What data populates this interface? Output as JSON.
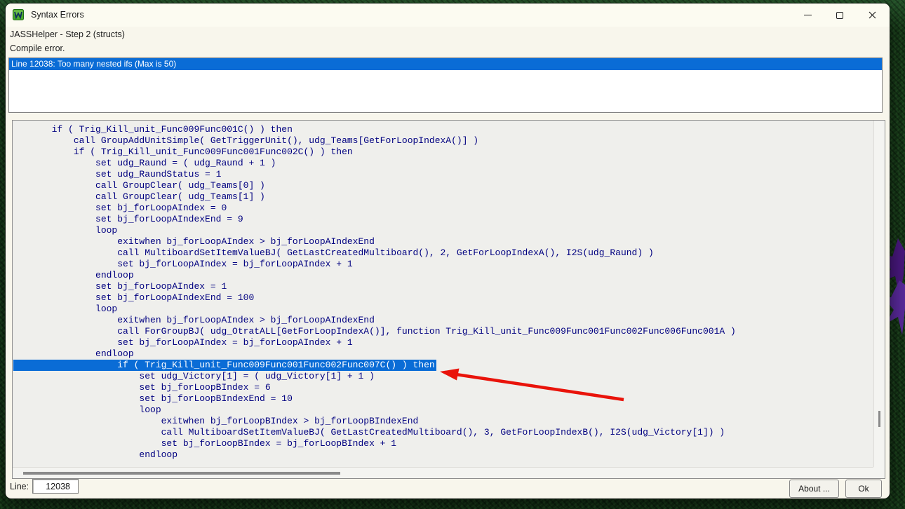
{
  "window": {
    "title": "Syntax Errors",
    "icon": "jasshelper-app-icon",
    "subtitle": "JASSHelper - Step 2 (structs)",
    "status_message": "Compile error."
  },
  "error_list": {
    "items": [
      {
        "text": "Line 12038: Too many nested ifs (Max is 50)",
        "selected": true
      }
    ]
  },
  "code_view": {
    "highlighted_line_index": 21,
    "lines": [
      "       if ( Trig_Kill_unit_Func009Func001C() ) then",
      "           call GroupAddUnitSimple( GetTriggerUnit(), udg_Teams[GetForLoopIndexA()] )",
      "           if ( Trig_Kill_unit_Func009Func001Func002C() ) then",
      "               set udg_Raund = ( udg_Raund + 1 )",
      "               set udg_RaundStatus = 1",
      "               call GroupClear( udg_Teams[0] )",
      "               call GroupClear( udg_Teams[1] )",
      "               set bj_forLoopAIndex = 0",
      "               set bj_forLoopAIndexEnd = 9",
      "               loop",
      "                   exitwhen bj_forLoopAIndex > bj_forLoopAIndexEnd",
      "                   call MultiboardSetItemValueBJ( GetLastCreatedMultiboard(), 2, GetForLoopIndexA(), I2S(udg_Raund) )",
      "                   set bj_forLoopAIndex = bj_forLoopAIndex + 1",
      "               endloop",
      "               set bj_forLoopAIndex = 1",
      "               set bj_forLoopAIndexEnd = 100",
      "               loop",
      "                   exitwhen bj_forLoopAIndex > bj_forLoopAIndexEnd",
      "                   call ForGroupBJ( udg_OtratALL[GetForLoopIndexA()], function Trig_Kill_unit_Func009Func001Func002Func006Func001A )",
      "                   set bj_forLoopAIndex = bj_forLoopAIndex + 1",
      "               endloop",
      "                   if ( Trig_Kill_unit_Func009Func001Func002Func007C() ) then",
      "                       set udg_Victory[1] = ( udg_Victory[1] + 1 )",
      "                       set bj_forLoopBIndex = 6",
      "                       set bj_forLoopBIndexEnd = 10",
      "                       loop",
      "                           exitwhen bj_forLoopBIndex > bj_forLoopBIndexEnd",
      "                           call MultiboardSetItemValueBJ( GetLastCreatedMultiboard(), 3, GetForLoopIndexB(), I2S(udg_Victory[1]) )",
      "                           set bj_forLoopBIndex = bj_forLoopBIndex + 1",
      "                       endloop"
    ]
  },
  "footer": {
    "line_label": "Line:",
    "line_value": "12038",
    "about_button": "About ...",
    "ok_button": "Ok"
  },
  "annotation": {
    "type": "red-arrow",
    "points_at": "highlighted code line"
  },
  "colors": {
    "selection_blue": "#0a6cd6",
    "code_text_navy": "#000080",
    "arrow_red": "#e9130a",
    "desktop_green": "#16391a",
    "doodad_purple": "#49187f",
    "window_cream": "#f8f6ec"
  }
}
